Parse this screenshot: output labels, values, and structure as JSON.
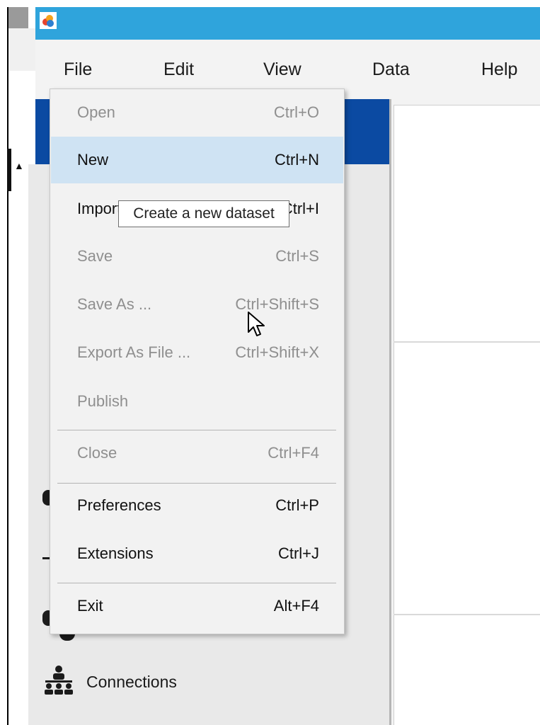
{
  "menubar": {
    "items": [
      {
        "label": "File"
      },
      {
        "label": "Edit"
      },
      {
        "label": "View"
      },
      {
        "label": "Data"
      },
      {
        "label": "Help"
      }
    ]
  },
  "file_menu": {
    "items": [
      {
        "label": "Open",
        "shortcut": "Ctrl+O",
        "enabled": false
      },
      {
        "label": "New",
        "shortcut": "Ctrl+N",
        "enabled": true,
        "highlighted": true
      },
      {
        "label": "Import",
        "shortcut": "Ctrl+I",
        "enabled": true
      },
      {
        "label": "Save",
        "shortcut": "Ctrl+S",
        "enabled": false
      },
      {
        "label": "Save As ...",
        "shortcut": "Ctrl+Shift+S",
        "enabled": false
      },
      {
        "label": "Export As File ...",
        "shortcut": "Ctrl+Shift+X",
        "enabled": false
      },
      {
        "label": "Publish",
        "shortcut": "",
        "enabled": false
      },
      {
        "label": "Close",
        "shortcut": "Ctrl+F4",
        "enabled": false
      },
      {
        "label": "Preferences",
        "shortcut": "Ctrl+P",
        "enabled": true
      },
      {
        "label": "Extensions",
        "shortcut": "Ctrl+J",
        "enabled": true
      },
      {
        "label": "Exit",
        "shortcut": "Alt+F4",
        "enabled": true
      }
    ]
  },
  "tooltip": {
    "text": "Create a new dataset"
  },
  "sidebar": {
    "connections_label": "Connections"
  },
  "colors": {
    "titlebar": "#2fa4dc",
    "header_blue": "#0b4aa2",
    "menu_hover": "#cfe3f3",
    "disabled_text": "#8f8f8f"
  }
}
